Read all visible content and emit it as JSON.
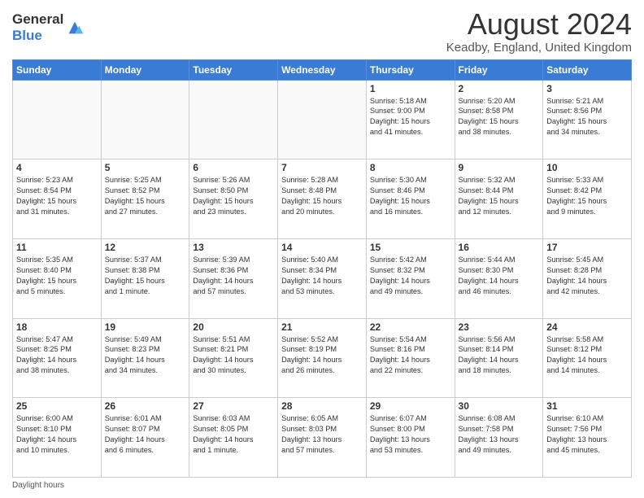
{
  "logo": {
    "general": "General",
    "blue": "Blue"
  },
  "header": {
    "title": "August 2024",
    "subtitle": "Keadby, England, United Kingdom"
  },
  "days_of_week": [
    "Sunday",
    "Monday",
    "Tuesday",
    "Wednesday",
    "Thursday",
    "Friday",
    "Saturday"
  ],
  "weeks": [
    [
      {
        "day": "",
        "info": ""
      },
      {
        "day": "",
        "info": ""
      },
      {
        "day": "",
        "info": ""
      },
      {
        "day": "",
        "info": ""
      },
      {
        "day": "1",
        "info": "Sunrise: 5:18 AM\nSunset: 9:00 PM\nDaylight: 15 hours\nand 41 minutes."
      },
      {
        "day": "2",
        "info": "Sunrise: 5:20 AM\nSunset: 8:58 PM\nDaylight: 15 hours\nand 38 minutes."
      },
      {
        "day": "3",
        "info": "Sunrise: 5:21 AM\nSunset: 8:56 PM\nDaylight: 15 hours\nand 34 minutes."
      }
    ],
    [
      {
        "day": "4",
        "info": "Sunrise: 5:23 AM\nSunset: 8:54 PM\nDaylight: 15 hours\nand 31 minutes."
      },
      {
        "day": "5",
        "info": "Sunrise: 5:25 AM\nSunset: 8:52 PM\nDaylight: 15 hours\nand 27 minutes."
      },
      {
        "day": "6",
        "info": "Sunrise: 5:26 AM\nSunset: 8:50 PM\nDaylight: 15 hours\nand 23 minutes."
      },
      {
        "day": "7",
        "info": "Sunrise: 5:28 AM\nSunset: 8:48 PM\nDaylight: 15 hours\nand 20 minutes."
      },
      {
        "day": "8",
        "info": "Sunrise: 5:30 AM\nSunset: 8:46 PM\nDaylight: 15 hours\nand 16 minutes."
      },
      {
        "day": "9",
        "info": "Sunrise: 5:32 AM\nSunset: 8:44 PM\nDaylight: 15 hours\nand 12 minutes."
      },
      {
        "day": "10",
        "info": "Sunrise: 5:33 AM\nSunset: 8:42 PM\nDaylight: 15 hours\nand 9 minutes."
      }
    ],
    [
      {
        "day": "11",
        "info": "Sunrise: 5:35 AM\nSunset: 8:40 PM\nDaylight: 15 hours\nand 5 minutes."
      },
      {
        "day": "12",
        "info": "Sunrise: 5:37 AM\nSunset: 8:38 PM\nDaylight: 15 hours\nand 1 minute."
      },
      {
        "day": "13",
        "info": "Sunrise: 5:39 AM\nSunset: 8:36 PM\nDaylight: 14 hours\nand 57 minutes."
      },
      {
        "day": "14",
        "info": "Sunrise: 5:40 AM\nSunset: 8:34 PM\nDaylight: 14 hours\nand 53 minutes."
      },
      {
        "day": "15",
        "info": "Sunrise: 5:42 AM\nSunset: 8:32 PM\nDaylight: 14 hours\nand 49 minutes."
      },
      {
        "day": "16",
        "info": "Sunrise: 5:44 AM\nSunset: 8:30 PM\nDaylight: 14 hours\nand 46 minutes."
      },
      {
        "day": "17",
        "info": "Sunrise: 5:45 AM\nSunset: 8:28 PM\nDaylight: 14 hours\nand 42 minutes."
      }
    ],
    [
      {
        "day": "18",
        "info": "Sunrise: 5:47 AM\nSunset: 8:25 PM\nDaylight: 14 hours\nand 38 minutes."
      },
      {
        "day": "19",
        "info": "Sunrise: 5:49 AM\nSunset: 8:23 PM\nDaylight: 14 hours\nand 34 minutes."
      },
      {
        "day": "20",
        "info": "Sunrise: 5:51 AM\nSunset: 8:21 PM\nDaylight: 14 hours\nand 30 minutes."
      },
      {
        "day": "21",
        "info": "Sunrise: 5:52 AM\nSunset: 8:19 PM\nDaylight: 14 hours\nand 26 minutes."
      },
      {
        "day": "22",
        "info": "Sunrise: 5:54 AM\nSunset: 8:16 PM\nDaylight: 14 hours\nand 22 minutes."
      },
      {
        "day": "23",
        "info": "Sunrise: 5:56 AM\nSunset: 8:14 PM\nDaylight: 14 hours\nand 18 minutes."
      },
      {
        "day": "24",
        "info": "Sunrise: 5:58 AM\nSunset: 8:12 PM\nDaylight: 14 hours\nand 14 minutes."
      }
    ],
    [
      {
        "day": "25",
        "info": "Sunrise: 6:00 AM\nSunset: 8:10 PM\nDaylight: 14 hours\nand 10 minutes."
      },
      {
        "day": "26",
        "info": "Sunrise: 6:01 AM\nSunset: 8:07 PM\nDaylight: 14 hours\nand 6 minutes."
      },
      {
        "day": "27",
        "info": "Sunrise: 6:03 AM\nSunset: 8:05 PM\nDaylight: 14 hours\nand 1 minute."
      },
      {
        "day": "28",
        "info": "Sunrise: 6:05 AM\nSunset: 8:03 PM\nDaylight: 13 hours\nand 57 minutes."
      },
      {
        "day": "29",
        "info": "Sunrise: 6:07 AM\nSunset: 8:00 PM\nDaylight: 13 hours\nand 53 minutes."
      },
      {
        "day": "30",
        "info": "Sunrise: 6:08 AM\nSunset: 7:58 PM\nDaylight: 13 hours\nand 49 minutes."
      },
      {
        "day": "31",
        "info": "Sunrise: 6:10 AM\nSunset: 7:56 PM\nDaylight: 13 hours\nand 45 minutes."
      }
    ]
  ],
  "footer": "Daylight hours"
}
